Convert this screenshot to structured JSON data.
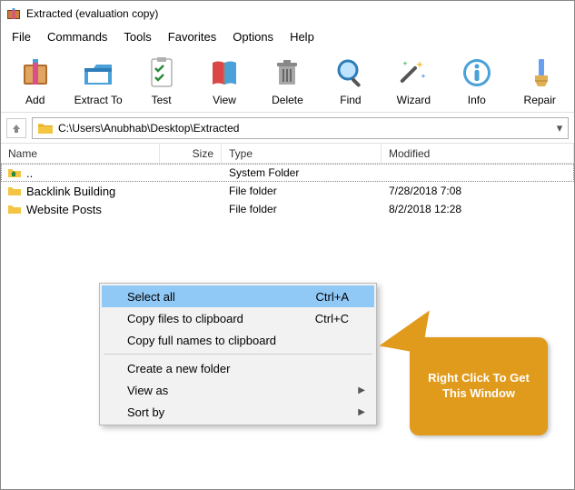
{
  "window": {
    "title": "Extracted (evaluation copy)"
  },
  "menubar": {
    "file": "File",
    "commands": "Commands",
    "tools": "Tools",
    "favorites": "Favorites",
    "options": "Options",
    "help": "Help"
  },
  "toolbar": {
    "add": "Add",
    "extract": "Extract To",
    "test": "Test",
    "view": "View",
    "delete": "Delete",
    "find": "Find",
    "wizard": "Wizard",
    "info": "Info",
    "repair": "Repair"
  },
  "address": {
    "path": "C:\\Users\\Anubhab\\Desktop\\Extracted"
  },
  "columns": {
    "name": "Name",
    "size": "Size",
    "type": "Type",
    "modified": "Modified"
  },
  "rows": {
    "up": {
      "name": "..",
      "type": "System Folder",
      "modified": ""
    },
    "backlnk": {
      "name": "Backlink Building",
      "type": "File folder",
      "modified": "7/28/2018 7:08"
    },
    "posts": {
      "name": "Website Posts",
      "type": "File folder",
      "modified": "8/2/2018 12:28"
    }
  },
  "context": {
    "select_all": {
      "label": "Select all",
      "shortcut": "Ctrl+A"
    },
    "copy_files": {
      "label": "Copy files to clipboard",
      "shortcut": "Ctrl+C"
    },
    "copy_names": {
      "label": "Copy full names to clipboard",
      "shortcut": ""
    },
    "create_folder": {
      "label": "Create a new folder",
      "shortcut": ""
    },
    "view_as": {
      "label": "View as",
      "shortcut": ""
    },
    "sort_by": {
      "label": "Sort by",
      "shortcut": ""
    }
  },
  "callout": {
    "text": "Right Click To Get This Window"
  }
}
